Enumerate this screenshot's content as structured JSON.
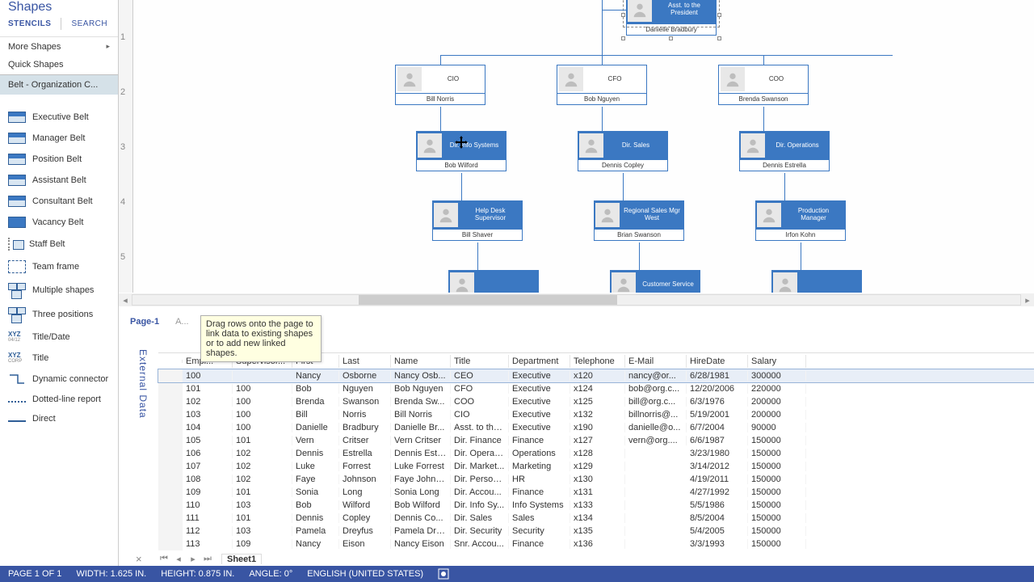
{
  "shapes_panel": {
    "title": "Shapes",
    "tabs": {
      "stencils": "STENCILS",
      "search": "SEARCH"
    },
    "more_shapes": "More Shapes",
    "quick_shapes": "Quick Shapes",
    "selected_stencil": "Belt - Organization C...",
    "items": [
      "Executive Belt",
      "Manager Belt",
      "Position Belt",
      "Assistant Belt",
      "Consultant Belt",
      "Vacancy Belt",
      "Staff Belt",
      "Team frame",
      "Multiple shapes",
      "Three positions",
      "Title/Date",
      "Title",
      "Dynamic connector",
      "Dotted-line report",
      "Direct"
    ]
  },
  "ruler_marks": [
    "1",
    "2",
    "3",
    "4",
    "5"
  ],
  "org_chart": {
    "asst": {
      "role": "Asst. to the President",
      "name": "Danielle Bradbury"
    },
    "row2": [
      {
        "role": "CIO",
        "name": "Bill Norris"
      },
      {
        "role": "CFO",
        "name": "Bob Nguyen"
      },
      {
        "role": "COO",
        "name": "Brenda Swanson"
      }
    ],
    "row3": [
      {
        "role": "Dir. Info Systems",
        "name": "Bob Wilford"
      },
      {
        "role": "Dir. Sales",
        "name": "Dennis Copley"
      },
      {
        "role": "Dir. Operations",
        "name": "Dennis Estrella"
      }
    ],
    "row4": [
      {
        "role": "Help Desk Supervisor",
        "name": "Bill Shaver"
      },
      {
        "role": "Regional Sales Mgr West",
        "name": "Brian Swanson"
      },
      {
        "role": "Production Manager",
        "name": "Irfon Kohn"
      }
    ],
    "row5_label": "Customer Service"
  },
  "page_tabs": {
    "page1": "Page-1",
    "all": "A..."
  },
  "tooltip": "Drag rows onto the page to link data to existing shapes or to add new linked shapes.",
  "external_data_label": "External Data",
  "grid": {
    "headers": [
      "",
      "Empl...",
      "Supervisor...",
      "First",
      "Last",
      "Name",
      "Title",
      "Department",
      "Telephone",
      "E-Mail",
      "HireDate",
      "Salary"
    ],
    "rows": [
      [
        "100",
        "",
        "Nancy",
        "Osborne",
        "Nancy Osb...",
        "CEO",
        "Executive",
        "x120",
        "nancy@or...",
        "6/28/1981",
        "300000"
      ],
      [
        "101",
        "100",
        "Bob",
        "Nguyen",
        "Bob Nguyen",
        "CFO",
        "Executive",
        "x124",
        "bob@org.c...",
        "12/20/2006",
        "220000"
      ],
      [
        "102",
        "100",
        "Brenda",
        "Swanson",
        "Brenda Sw...",
        "COO",
        "Executive",
        "x125",
        "bill@org.c...",
        "6/3/1976",
        "200000"
      ],
      [
        "103",
        "100",
        "Bill",
        "Norris",
        "Bill Norris",
        "CIO",
        "Executive",
        "x132",
        "billnorris@...",
        "5/19/2001",
        "200000"
      ],
      [
        "104",
        "100",
        "Danielle",
        "Bradbury",
        "Danielle Br...",
        "Asst. to the...",
        "Executive",
        "x190",
        "danielle@o...",
        "6/7/2004",
        "90000"
      ],
      [
        "105",
        "101",
        "Vern",
        "Critser",
        "Vern Critser",
        "Dir. Finance",
        "Finance",
        "x127",
        "vern@org....",
        "6/6/1987",
        "150000"
      ],
      [
        "106",
        "102",
        "Dennis",
        "Estrella",
        "Dennis Estr...",
        "Dir. Operati...",
        "Operations",
        "x128",
        "",
        "3/23/1980",
        "150000"
      ],
      [
        "107",
        "102",
        "Luke",
        "Forrest",
        "Luke Forrest",
        "Dir. Market...",
        "Marketing",
        "x129",
        "",
        "3/14/2012",
        "150000"
      ],
      [
        "108",
        "102",
        "Faye",
        "Johnson",
        "Faye Johns...",
        "Dir. Person...",
        "HR",
        "x130",
        "",
        "4/19/2011",
        "150000"
      ],
      [
        "109",
        "101",
        "Sonia",
        "Long",
        "Sonia Long",
        "Dir. Accou...",
        "Finance",
        "x131",
        "",
        "4/27/1992",
        "150000"
      ],
      [
        "110",
        "103",
        "Bob",
        "Wilford",
        "Bob Wilford",
        "Dir. Info Sy...",
        "Info Systems",
        "x133",
        "",
        "5/5/1986",
        "150000"
      ],
      [
        "111",
        "101",
        "Dennis",
        "Copley",
        "Dennis Co...",
        "Dir. Sales",
        "Sales",
        "x134",
        "",
        "8/5/2004",
        "150000"
      ],
      [
        "112",
        "103",
        "Pamela",
        "Dreyfus",
        "Pamela Dre...",
        "Dir. Security",
        "Security",
        "x135",
        "",
        "5/4/2005",
        "150000"
      ],
      [
        "113",
        "109",
        "Nancy",
        "Eison",
        "Nancy Eison",
        "Snr. Accou...",
        "Finance",
        "x136",
        "",
        "3/3/1993",
        "150000"
      ]
    ],
    "selected_row": 0,
    "sheet": "Sheet1"
  },
  "status": {
    "page": "PAGE 1 OF 1",
    "width": "WIDTH: 1.625 IN.",
    "height": "HEIGHT: 0.875 IN.",
    "angle": "ANGLE: 0°",
    "lang": "ENGLISH (UNITED STATES)"
  }
}
